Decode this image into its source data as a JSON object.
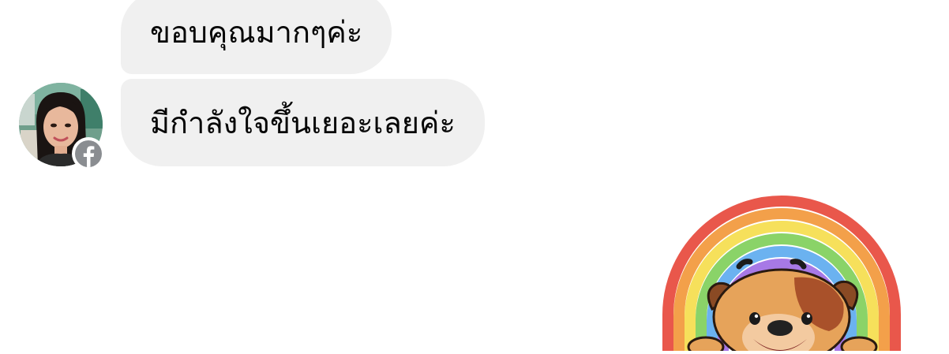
{
  "messages": [
    {
      "text": "ขอบคุณมากๆค่ะ"
    },
    {
      "text": "มีกำลังใจขึ้นเยอะเลยค่ะ"
    }
  ],
  "sender": {
    "avatar": "profile-photo",
    "badge_icon": "facebook-icon"
  },
  "sticker": {
    "name": "rainbow-dog-sticker"
  },
  "colors": {
    "bubble_bg": "#f0f0f0",
    "text": "#050505",
    "badge": "#8a8d91",
    "background": "#ffffff"
  }
}
